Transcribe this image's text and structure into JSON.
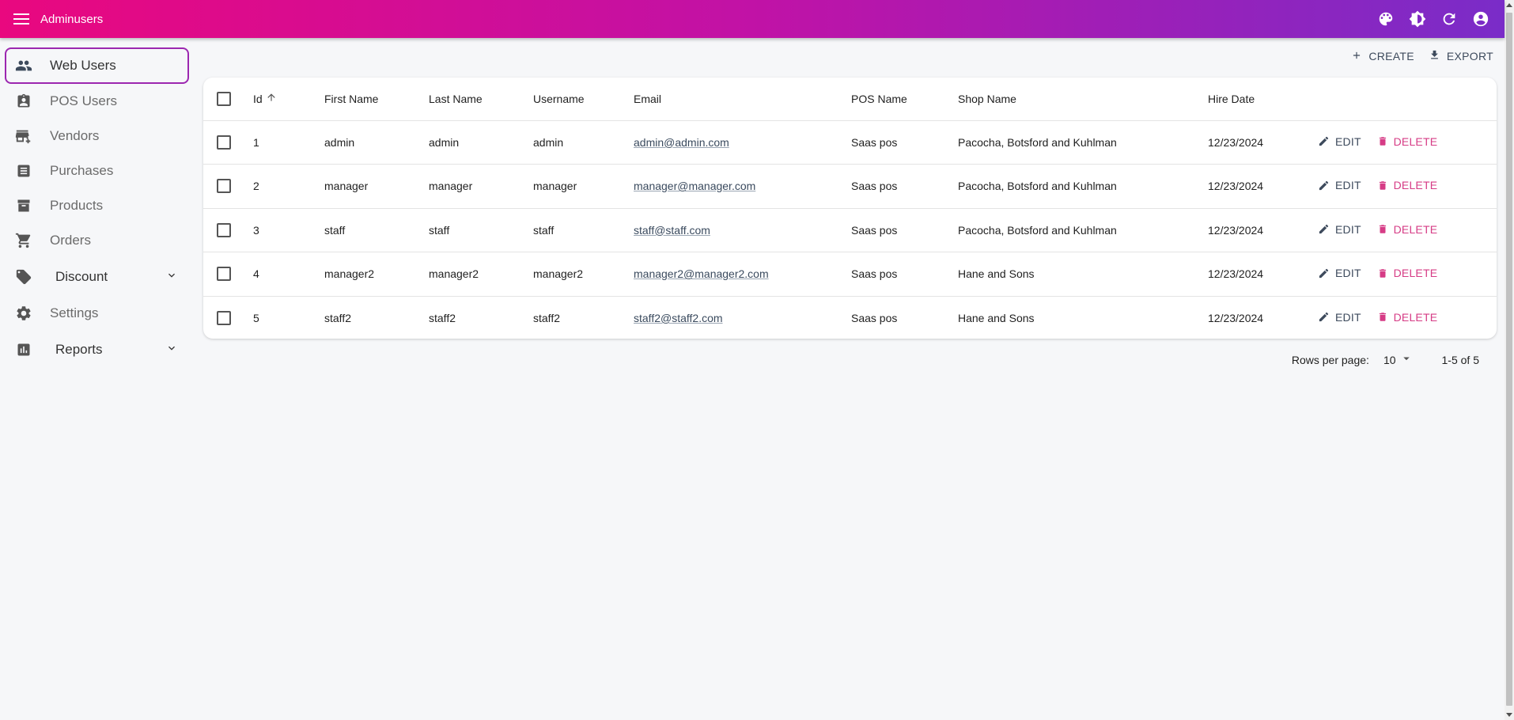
{
  "app": {
    "title": "Adminusers"
  },
  "colors": {
    "accent": "#9c27b0",
    "gradient_start": "#e9087f",
    "gradient_end": "#7a2cc8",
    "delete": "#d63c86"
  },
  "appbar": {
    "icons": [
      "palette-icon",
      "brightness-icon",
      "refresh-icon",
      "account-circle-icon"
    ]
  },
  "sidebar": {
    "items": [
      {
        "label": "Web Users",
        "icon": "people-icon",
        "active": true
      },
      {
        "label": "POS Users",
        "icon": "badge-icon"
      },
      {
        "label": "Vendors",
        "icon": "store-add-icon"
      },
      {
        "label": "Purchases",
        "icon": "receipt-icon"
      },
      {
        "label": "Products",
        "icon": "archive-icon"
      },
      {
        "label": "Orders",
        "icon": "cart-icon"
      },
      {
        "label": "Discount",
        "icon": "tag-icon",
        "expandable": true
      },
      {
        "label": "Settings",
        "icon": "gear-icon"
      },
      {
        "label": "Reports",
        "icon": "chart-icon",
        "expandable": true
      }
    ]
  },
  "toolbar": {
    "create_label": "CREATE",
    "export_label": "EXPORT"
  },
  "table": {
    "columns": {
      "id": "Id",
      "first_name": "First Name",
      "last_name": "Last Name",
      "username": "Username",
      "email": "Email",
      "pos_name": "POS Name",
      "shop_name": "Shop Name",
      "hire_date": "Hire Date"
    },
    "sort": {
      "column": "Id",
      "direction": "asc"
    },
    "rows": [
      {
        "id": "1",
        "first_name": "admin",
        "last_name": "admin",
        "username": "admin",
        "email": "admin@admin.com",
        "pos_name": "Saas pos",
        "shop_name": "Pacocha, Botsford and Kuhlman",
        "hire_date": "12/23/2024"
      },
      {
        "id": "2",
        "first_name": "manager",
        "last_name": "manager",
        "username": "manager",
        "email": "manager@manager.com",
        "pos_name": "Saas pos",
        "shop_name": "Pacocha, Botsford and Kuhlman",
        "hire_date": "12/23/2024"
      },
      {
        "id": "3",
        "first_name": "staff",
        "last_name": "staff",
        "username": "staff",
        "email": "staff@staff.com",
        "pos_name": "Saas pos",
        "shop_name": "Pacocha, Botsford and Kuhlman",
        "hire_date": "12/23/2024"
      },
      {
        "id": "4",
        "first_name": "manager2",
        "last_name": "manager2",
        "username": "manager2",
        "email": "manager2@manager2.com",
        "pos_name": "Saas pos",
        "shop_name": "Hane and Sons",
        "hire_date": "12/23/2024"
      },
      {
        "id": "5",
        "first_name": "staff2",
        "last_name": "staff2",
        "username": "staff2",
        "email": "staff2@staff2.com",
        "pos_name": "Saas pos",
        "shop_name": "Hane and Sons",
        "hire_date": "12/23/2024"
      }
    ],
    "row_actions": {
      "edit_label": "EDIT",
      "delete_label": "DELETE"
    }
  },
  "pagination": {
    "rows_per_page_label": "Rows per page:",
    "rows_per_page": "10",
    "range": "1-5 of 5"
  }
}
